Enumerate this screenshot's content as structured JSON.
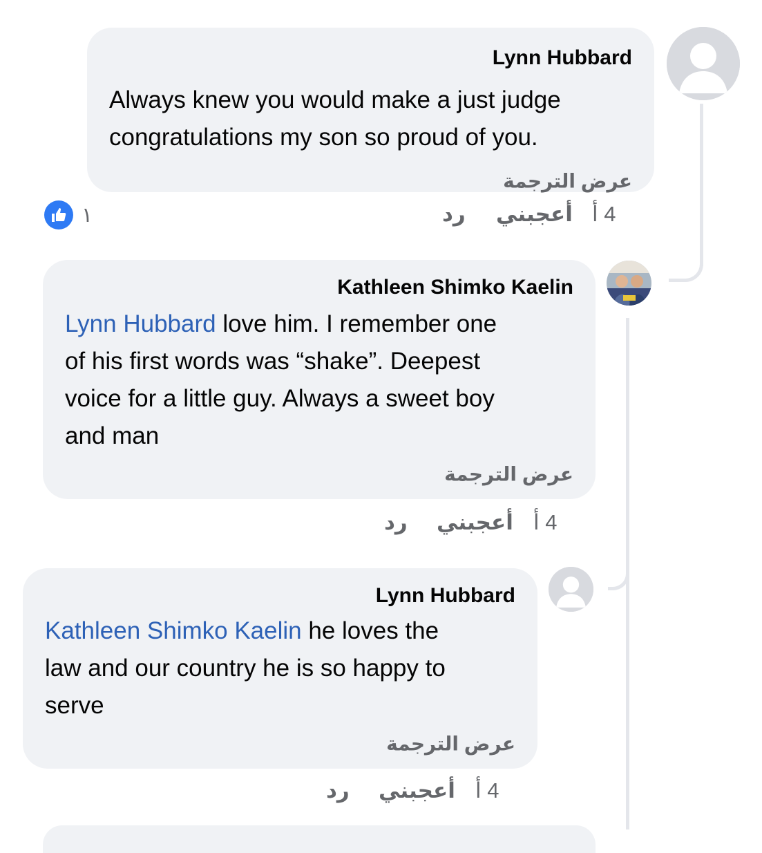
{
  "comments": [
    {
      "author": "Lynn Hubbard",
      "mention": "",
      "text": "Always knew you would make a just judge\ncongratulations my son so proud of you.",
      "translate_label": "عرض الترجمة",
      "time": "4 أ",
      "like_label": "أعجبني",
      "reply_label": "رد",
      "reactions": {
        "count": "١",
        "icon": "thumbs-up-icon"
      }
    },
    {
      "author": "Kathleen Shimko Kaelin",
      "mention": "Lynn Hubbard",
      "text": " love him.  I remember one\nof his first words was “shake”. Deepest\nvoice for a little guy. Always a sweet boy\nand man",
      "translate_label": "عرض الترجمة",
      "time": "4 أ",
      "like_label": "أعجبني",
      "reply_label": "رد"
    },
    {
      "author": "Lynn Hubbard",
      "mention": "Kathleen Shimko Kaelin",
      "text": " he loves the\nlaw and our country he is so happy to\nserve",
      "translate_label": "عرض الترجمة",
      "time": "4 أ",
      "like_label": "أعجبني",
      "reply_label": "رد"
    }
  ],
  "colors": {
    "bubble": "#f0f2f5",
    "mention": "#2d61b6",
    "like": "#2e7af4",
    "meta": "#65676b"
  }
}
